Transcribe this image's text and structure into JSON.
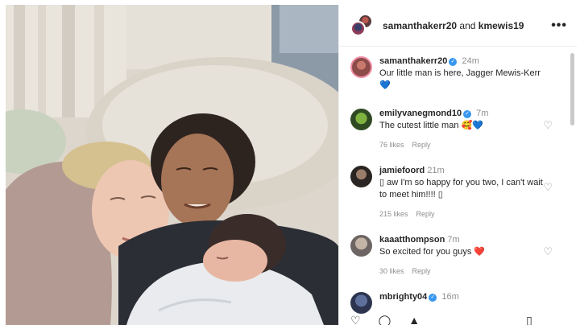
{
  "header": {
    "user1": "samanthakerr20",
    "joiner": " and ",
    "user2": "kmewis19",
    "more_icon": "•••"
  },
  "caption": {
    "user": "samanthakerr20",
    "time": "24m",
    "text": "Our little man is here, Jagger Mewis-Kerr",
    "emoji": "💙"
  },
  "comments": [
    {
      "user": "emilyvanegmond10",
      "verified": true,
      "time": "7m",
      "text": "The cutest little man",
      "emoji": "🥰💙",
      "likes": "76 likes",
      "reply": "Reply"
    },
    {
      "user": "jamiefoord",
      "verified": false,
      "time": "21m",
      "text": "▯ aw I'm so happy for you two, I can't wait to meet him!!!! ▯",
      "emoji": "",
      "likes": "215 likes",
      "reply": "Reply"
    },
    {
      "user": "kaaatthompson",
      "verified": false,
      "time": "7m",
      "text": "So excited for you guys",
      "emoji": "❤️",
      "likes": "30 likes",
      "reply": "Reply"
    },
    {
      "user": "mbrighty04",
      "verified": true,
      "time": "16m",
      "text": "",
      "emoji": "",
      "likes": "",
      "reply": ""
    }
  ],
  "icons": {
    "heart": "♡",
    "verified": "✓"
  },
  "colors": {
    "verified": "#3897f0",
    "muted": "#8e8e8e",
    "text": "#262626"
  }
}
